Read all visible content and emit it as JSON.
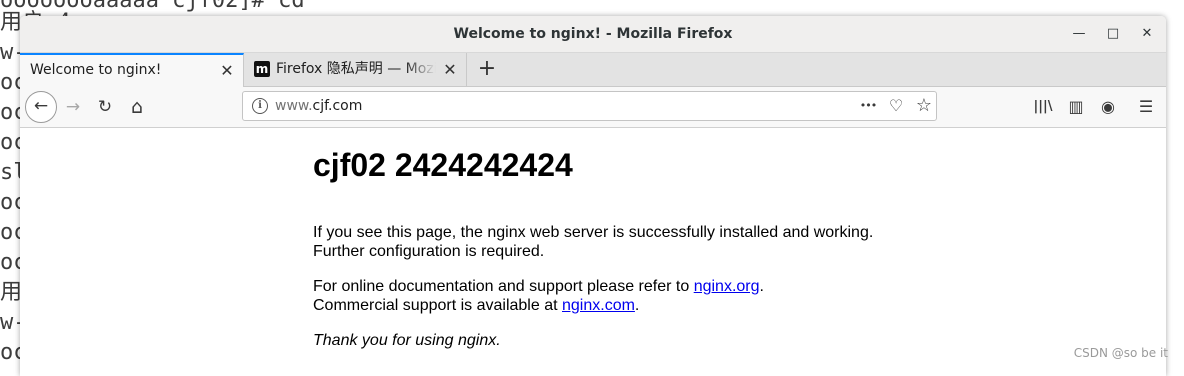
{
  "terminal": {
    "lines": [
      "oooooooaaaaa cjf02]# cd",
      "用户 4",
      "w-",
      "oc",
      "oc",
      "oc",
      "sl",
      "oc",
      "oc",
      "oc",
      "用",
      "w-",
      "oc"
    ]
  },
  "window": {
    "title": "Welcome to nginx! - Mozilla Firefox",
    "minimize_glyph": "—",
    "maximize_glyph": "□",
    "close_glyph": "✕"
  },
  "tabs": [
    {
      "label": "Welcome to nginx!",
      "close": "✕",
      "active": true
    },
    {
      "label": "Firefox 隐私声明 — Mozilla",
      "close": "✕",
      "active": false,
      "favicon": "m"
    }
  ],
  "new_tab_glyph": "+",
  "toolbar": {
    "back_glyph": "←",
    "forward_glyph": "→",
    "reload_glyph": "↻",
    "home_glyph": "⌂",
    "url_prefix": "www.",
    "url_domain": "cjf.com",
    "page_actions_glyph": "•••",
    "pocket_glyph": "♡",
    "bookmark_glyph": "☆",
    "library_glyph": "|||\\",
    "sidebar_glyph": "▥",
    "account_glyph": "◉",
    "menu_glyph": "☰"
  },
  "page": {
    "heading": "cjf02 2424242424",
    "p1_line1": "If you see this page, the nginx web server is successfully installed and working.",
    "p1_line2": "Further configuration is required.",
    "p2_line1_before": "For online documentation and support please refer to ",
    "p2_line1_link": "nginx.org",
    "p2_line1_after": ".",
    "p2_line2_before": "Commercial support is available at ",
    "p2_line2_link": "nginx.com",
    "p2_line2_after": ".",
    "thanks": "Thank you for using nginx."
  },
  "watermark": "CSDN @so be it"
}
